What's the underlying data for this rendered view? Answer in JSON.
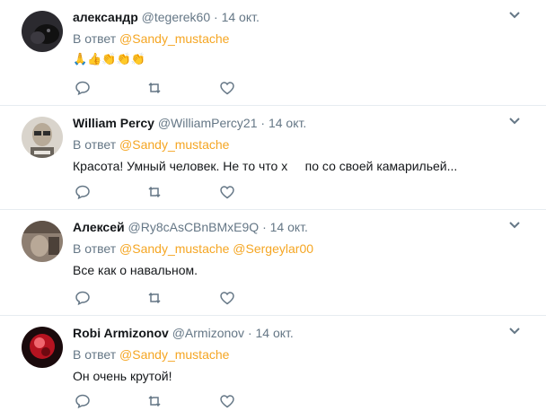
{
  "tweets": [
    {
      "name": "александр",
      "handle": "@tegerek60",
      "date": "· 14 окт.",
      "reply_prefix": "В ответ",
      "mentions": "@Sandy_mustache",
      "text": "🙏👍👏👏👏",
      "avatar_color": "#2b2a2f"
    },
    {
      "name": "William Percy",
      "handle": "@WilliamPercy21",
      "date": "· 14 окт.",
      "reply_prefix": "В ответ",
      "mentions": "@Sandy_mustache",
      "text": "Красота! Умный человек. Не то что х     по со своей камарильей...",
      "avatar_color": "#c8c2b8"
    },
    {
      "name": "Алексей",
      "handle": "@Ry8cAsCBnBMxE9Q",
      "date": "· 14 окт.",
      "reply_prefix": "В ответ",
      "mentions": "@Sandy_mustache @Sergeylar00",
      "text": "Все как о навальном.",
      "avatar_color": "#8e7f72"
    },
    {
      "name": "Robi Armizonov",
      "handle": "@Armizonov",
      "date": "· 14 окт.",
      "reply_prefix": "В ответ",
      "mentions": "@Sandy_mustache",
      "text": "Он очень крутой!",
      "avatar_color": "#c01722"
    }
  ],
  "colors": {
    "mention": "#f5a623",
    "secondary_text": "#657786",
    "divider": "#e6ecf0",
    "icon": "#657786"
  },
  "icons": [
    "reply-icon",
    "retweet-icon",
    "like-icon",
    "chevron-down-icon"
  ]
}
